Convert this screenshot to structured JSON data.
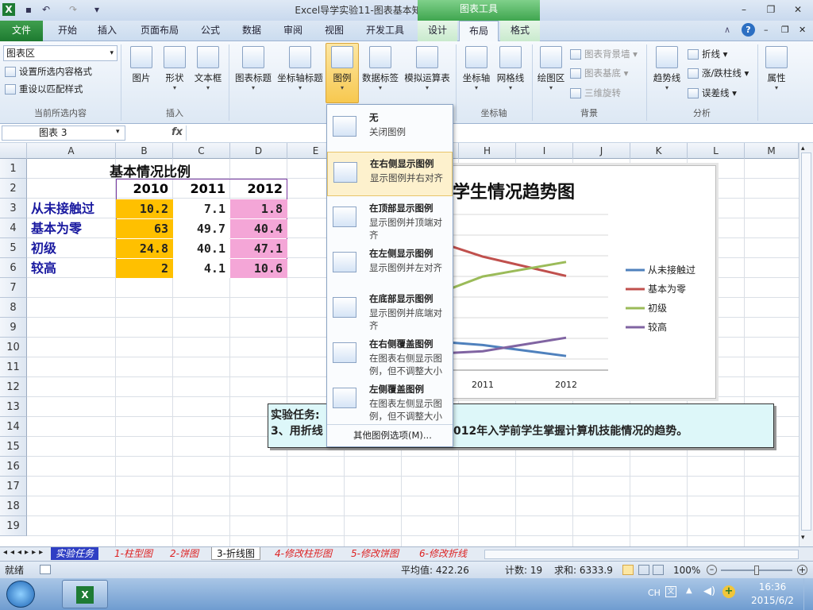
{
  "window": {
    "title": "Excel导学实验11-图表基本知识1 - Microsoft Excel",
    "context_tab": "图表工具"
  },
  "tabs": [
    "文件",
    "开始",
    "插入",
    "页面布局",
    "公式",
    "数据",
    "审阅",
    "视图",
    "开发工具",
    "设计",
    "布局",
    "格式"
  ],
  "ribbon": {
    "selection_dropdown": "图表区",
    "format_selection": "设置所选内容格式",
    "reset_style": "重设以匹配样式",
    "group_current": "当前所选内容",
    "insert_group": "插入",
    "picture": "图片",
    "shapes": "形状",
    "textbox": "文本框",
    "chart_title": "图表标题",
    "axis_titles": "坐标轴标题",
    "legend": "图例",
    "data_labels": "数据标签",
    "data_table": "模拟运算表",
    "axes": "坐标轴",
    "gridlines": "网格线",
    "axes_group": "坐标轴",
    "plot_area": "绘图区",
    "chart_wall": "图表背景墙",
    "chart_floor": "图表基底",
    "rotation_3d": "三维旋转",
    "bg_group": "背景",
    "trendline": "趋势线",
    "lines": "折线",
    "updown_bars": "涨/跌柱线",
    "error_bars": "误差线",
    "analysis_group": "分析",
    "properties": "属性"
  },
  "formula_bar": {
    "name_box": "图表 3",
    "fx": "fx"
  },
  "columns": [
    "A",
    "B",
    "C",
    "D",
    "E",
    "F",
    "G",
    "H",
    "I",
    "J",
    "K",
    "L",
    "M"
  ],
  "rows": [
    "1",
    "2",
    "3",
    "4",
    "5",
    "6",
    "7",
    "8",
    "9",
    "10",
    "11",
    "12",
    "13",
    "14",
    "15",
    "16",
    "17",
    "18",
    "19"
  ],
  "table": {
    "title": "基本情况比例",
    "years": [
      "2010",
      "2011",
      "2012"
    ],
    "rows": [
      {
        "label": "从未接触过",
        "values": [
          "10.2",
          "7.1",
          "1.8"
        ]
      },
      {
        "label": "基本为零",
        "values": [
          "63",
          "49.7",
          "40.4"
        ]
      },
      {
        "label": "初级",
        "values": [
          "24.8",
          "40.1",
          "47.1"
        ]
      },
      {
        "label": "较高",
        "values": [
          "2",
          "4.1",
          "10.6"
        ]
      }
    ]
  },
  "chart": {
    "title_visible": "学生情况趋势图",
    "x_labels_visible": [
      "2011",
      "2012"
    ],
    "legend": [
      "从未接触过",
      "基本为零",
      "初级",
      "较高"
    ],
    "colors": [
      "#4f81bd",
      "#c0504d",
      "#9bbb59",
      "#8064a2"
    ]
  },
  "chart_data": {
    "type": "line",
    "title": "学生情况趋势图",
    "categories": [
      "2010",
      "2011",
      "2012"
    ],
    "series": [
      {
        "name": "从未接触过",
        "values": [
          10.2,
          7.1,
          1.8
        ]
      },
      {
        "name": "基本为零",
        "values": [
          63,
          49.7,
          40.4
        ]
      },
      {
        "name": "初级",
        "values": [
          24.8,
          40.1,
          47.1
        ]
      },
      {
        "name": "较高",
        "values": [
          2,
          4.1,
          10.6
        ]
      }
    ],
    "legend_position": "right"
  },
  "legend_menu": [
    {
      "title": "无",
      "desc": "关闭图例"
    },
    {
      "title": "在右侧显示图例",
      "desc": "显示图例并右对齐"
    },
    {
      "title": "在顶部显示图例",
      "desc": "显示图例并顶端对齐"
    },
    {
      "title": "在左侧显示图例",
      "desc": "显示图例并左对齐"
    },
    {
      "title": "在底部显示图例",
      "desc": "显示图例并底端对齐"
    },
    {
      "title": "在右侧覆盖图例",
      "desc": "在图表右侧显示图例，但不调整大小"
    },
    {
      "title": "左侧覆盖图例",
      "desc": "在图表左侧显示图例，但不调整大小"
    }
  ],
  "legend_more": "其他图例选项(M)...",
  "task": {
    "line1": "实验任务:",
    "line2_pre": "3、用折线",
    "line2_post": "012年入学前学生掌握计算机技能情况的趋势。"
  },
  "sheets": [
    "实验任务",
    "1-柱型图",
    "2-饼图",
    "3-折线图",
    "4-修改柱形图",
    "5-修改饼图",
    "6-修改折线"
  ],
  "status": {
    "ready": "就绪",
    "average": "平均值: 422.26",
    "count": "计数: 19",
    "sum": "求和: 6333.9",
    "zoom": "100%"
  },
  "taskbar": {
    "lang": "CH",
    "time": "16:36",
    "date": "2015/6/2"
  }
}
